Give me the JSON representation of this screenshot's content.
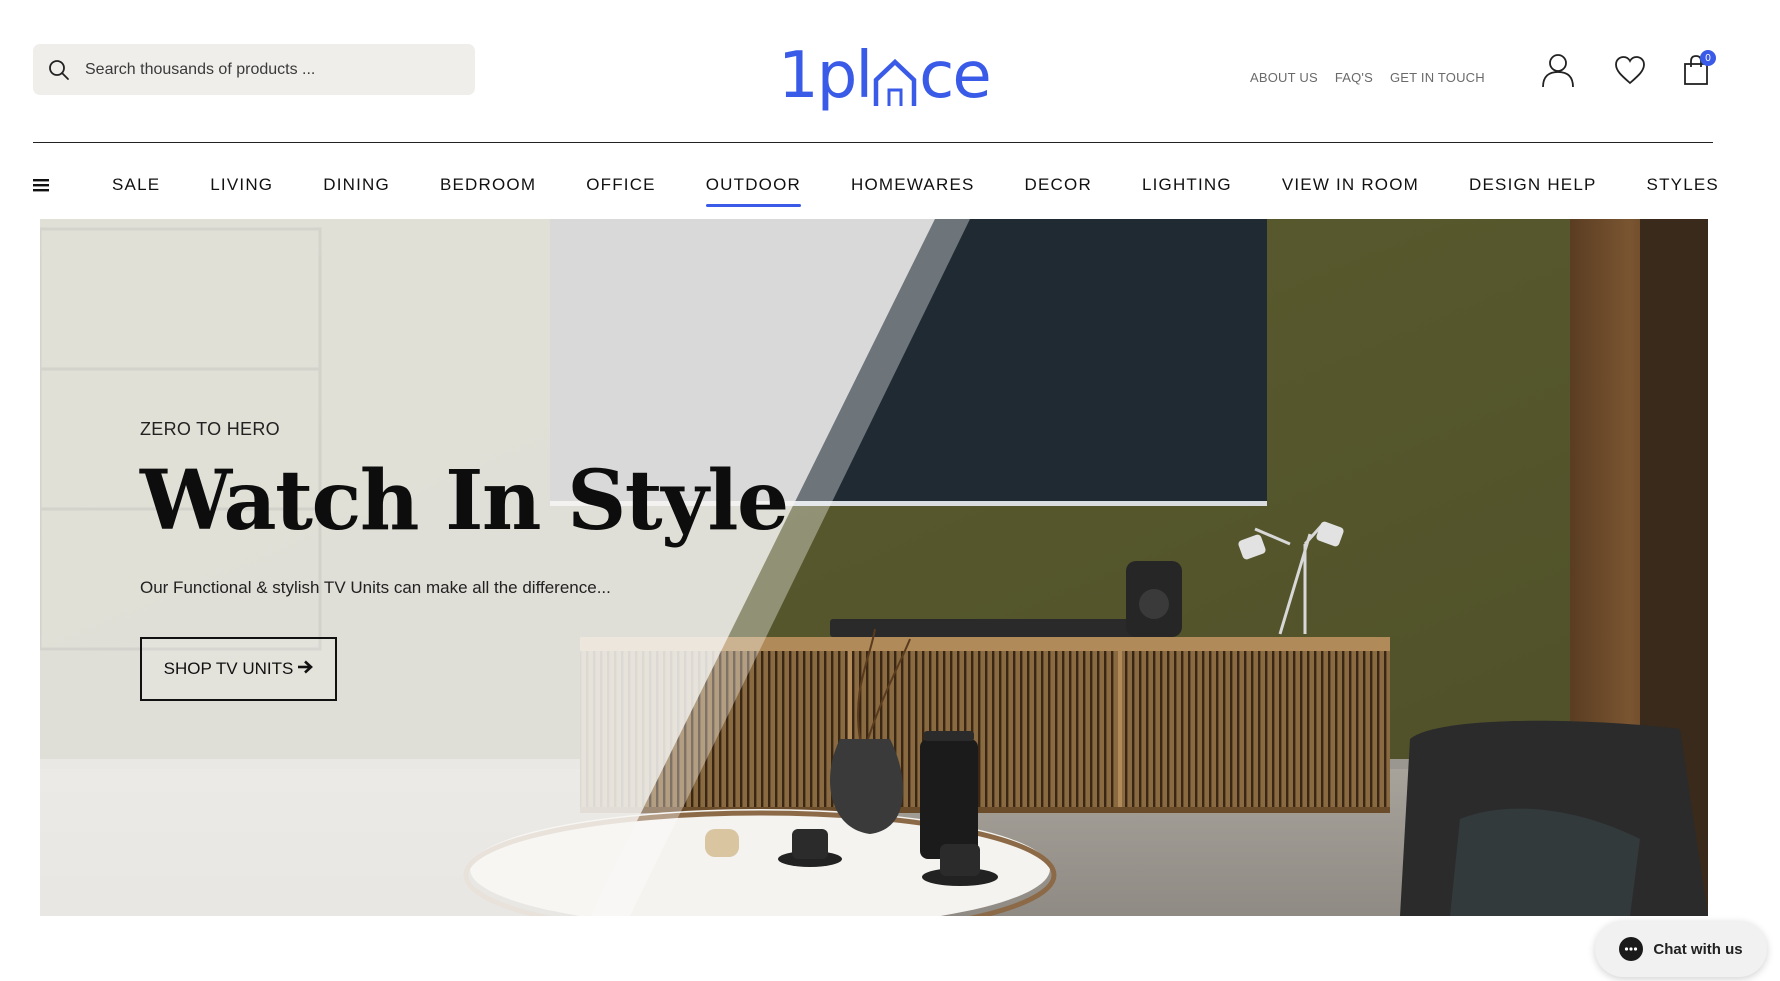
{
  "search": {
    "placeholder": "Search thousands of products ..."
  },
  "logo": {
    "part1": "1pl",
    "part2": "ce"
  },
  "top_links": [
    "ABOUT US",
    "FAQ'S",
    "GET IN TOUCH"
  ],
  "cart": {
    "count": "0"
  },
  "nav": {
    "items": [
      "SALE",
      "LIVING",
      "DINING",
      "BEDROOM",
      "OFFICE",
      "OUTDOOR",
      "HOMEWARES",
      "DECOR",
      "LIGHTING",
      "VIEW IN ROOM",
      "DESIGN HELP",
      "STYLES"
    ],
    "active": "OUTDOOR"
  },
  "hero": {
    "eyebrow": "ZERO TO HERO",
    "headline": "Watch In Style",
    "subtext": "Our Functional & stylish TV Units can make all the difference...",
    "cta": "SHOP TV UNITS"
  },
  "chat": {
    "label": "Chat with us"
  },
  "colors": {
    "brand": "#3a5be8",
    "hero_wall": "#59592d",
    "cabinet": "#8a6a40"
  }
}
